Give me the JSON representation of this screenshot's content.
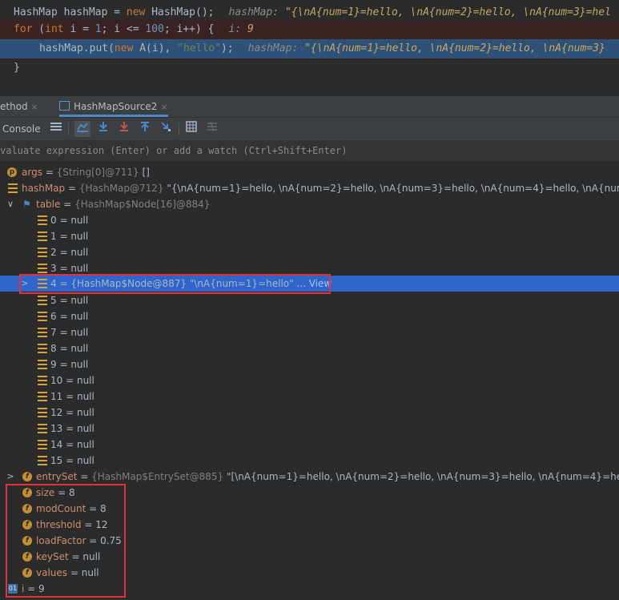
{
  "editor": {
    "lines": [
      {
        "a": "HashMap hashMap = ",
        "kw": "new",
        "b": " HashMap();",
        "hint_name": "hashMap:",
        "hint_value": "\"{\\nA{num=1}=hello, \\nA{num=2}=hello, \\nA{num=3}=hel"
      },
      {
        "kw": "for",
        "a": " (",
        "kw2": "int",
        "b": " i = ",
        "n1": "1",
        "c": "; i <= ",
        "n2": "100",
        "d": "; i++) {",
        "hint_name": "i:",
        "hint_value": "9"
      },
      {
        "a": "hashMap.put(",
        "kw": "new",
        "b": " A(i), ",
        "s": "\"hello\"",
        "c": ");",
        "hint_name": "hashMap:",
        "hint_value": "\"{\\nA{num=1}=hello, \\nA{num=2}=hello, \\nA{num=3}"
      },
      {
        "a": "}"
      }
    ]
  },
  "tabs": [
    {
      "label": "ethod",
      "close": "×"
    },
    {
      "label": "HashMapSource2",
      "close": "×"
    }
  ],
  "toolbar": {
    "console_label": "Console"
  },
  "eval": {
    "placeholder": "valuate expression (Enter) or add a watch (Ctrl+Shift+Enter)"
  },
  "vars": {
    "args": {
      "name": "args",
      "meta": "{String[0]@711}",
      "value": "[]"
    },
    "hashMap": {
      "name": "hashMap",
      "meta": "{HashMap@712}",
      "value": "\"{\\nA{num=1}=hello, \\nA{num=2}=hello, \\nA{num=3}=hello, \\nA{num=4}=hello, \\nA{num=5}=hello,"
    },
    "table": {
      "name": "table",
      "meta": "{HashMap$Node[16]@884}"
    },
    "table_items": [
      {
        "index": "0",
        "value": "null"
      },
      {
        "index": "1",
        "value": "null"
      },
      {
        "index": "2",
        "value": "null"
      },
      {
        "index": "3",
        "value": "null"
      },
      {
        "index": "4",
        "value": "{HashMap$Node@887} \"\\nA{num=1}=hello\"",
        "view": "... View"
      },
      {
        "index": "5",
        "value": "null"
      },
      {
        "index": "6",
        "value": "null"
      },
      {
        "index": "7",
        "value": "null"
      },
      {
        "index": "8",
        "value": "null"
      },
      {
        "index": "9",
        "value": "null"
      },
      {
        "index": "10",
        "value": "null"
      },
      {
        "index": "11",
        "value": "null"
      },
      {
        "index": "12",
        "value": "null"
      },
      {
        "index": "13",
        "value": "null"
      },
      {
        "index": "14",
        "value": "null"
      },
      {
        "index": "15",
        "value": "null"
      }
    ],
    "entrySet": {
      "name": "entrySet",
      "meta": "{HashMap$EntrySet@885}",
      "value": "\"[\\nA{num=1}=hello, \\nA{num=2}=hello, \\nA{num=3}=hello, \\nA{num=4}=hello, \\nA{num"
    },
    "fields": [
      {
        "name": "size",
        "value": "8"
      },
      {
        "name": "modCount",
        "value": "8"
      },
      {
        "name": "threshold",
        "value": "12"
      },
      {
        "name": "loadFactor",
        "value": "0.75"
      },
      {
        "name": "keySet",
        "value": "null"
      },
      {
        "name": "values",
        "value": "null"
      }
    ],
    "i": {
      "name": "i",
      "value": "9",
      "icon_label": "01"
    }
  },
  "colors": {
    "accent": "#2f65ca",
    "highlight": "#e0343a",
    "field_icon": "#c48f30"
  }
}
